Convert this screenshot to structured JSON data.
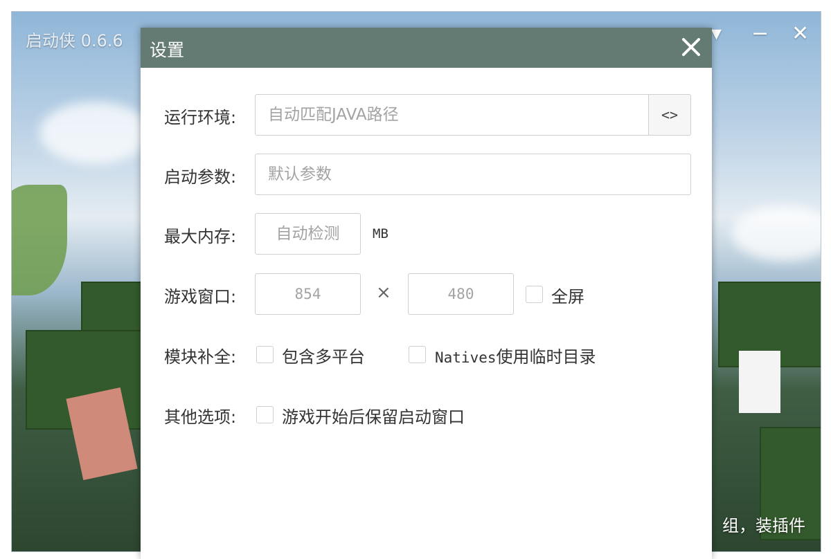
{
  "launcher": {
    "title": "启动侠 0.6.6",
    "controls": {
      "menu": "▾",
      "minimize": "−",
      "close": "✕"
    },
    "bottom_hint": "组，装插件"
  },
  "dialog": {
    "title": "设置",
    "rows": {
      "runtime": {
        "label": "运行环境:",
        "placeholder": "自动匹配JAVA路径",
        "browse": "<>"
      },
      "launch_args": {
        "label": "启动参数:",
        "placeholder": "默认参数"
      },
      "max_memory": {
        "label": "最大内存:",
        "placeholder": "自动检测",
        "unit": "MB"
      },
      "game_window": {
        "label": "游戏窗口:",
        "width_placeholder": "854",
        "times": "×",
        "height_placeholder": "480",
        "fullscreen": "全屏"
      },
      "module_completion": {
        "label": "模块补全:",
        "multi_platform": "包含多平台",
        "natives_prefix": "Natives",
        "natives_suffix": "使用临时目录"
      },
      "other_options": {
        "label": "其他选项:",
        "keep_window": "游戏开始后保留启动窗口"
      }
    }
  },
  "colors": {
    "header": "#637b72",
    "border": "#cfcfcf",
    "text": "#333333"
  }
}
